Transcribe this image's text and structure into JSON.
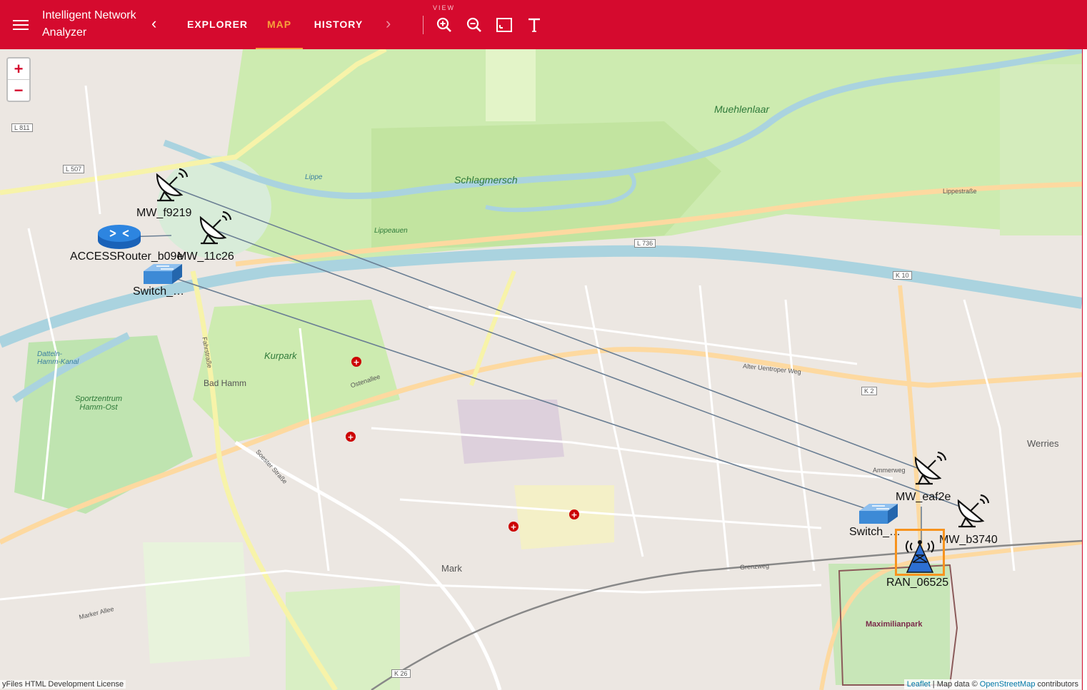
{
  "app": {
    "title": "Intelligent Network Analyzer"
  },
  "nav": {
    "tabs": [
      {
        "label": "EXPLORER",
        "active": false
      },
      {
        "label": "MAP",
        "active": true
      },
      {
        "label": "HISTORY",
        "active": false
      }
    ],
    "view_label": "VIEW"
  },
  "toolbar": {
    "tools": [
      "zoom-in-icon",
      "zoom-out-icon",
      "fit-content-icon",
      "text-icon"
    ]
  },
  "map": {
    "zoom_in": "+",
    "zoom_out": "−",
    "place_labels": {
      "muehlenlaar": "Muehlenlaar",
      "schlagmersch": "Schlagmersch",
      "kurpark": "Kurpark",
      "bad_hamm": "Bad Hamm",
      "werries": "Werries",
      "mark": "Mark",
      "maximilianpark": "Maximilianpark",
      "sportzentrum": "Sportzentrum Hamm-Ost",
      "datteln_kanal": "Datteln-Hamm-Kanal",
      "lippe": "Lippe",
      "lippeauen": "Lippeauen"
    },
    "street_labels": {
      "lippestrasse": "Lippestraße",
      "ostenallee": "Ostenallee",
      "alter_uentroper_weg": "Alter Uentroper Weg",
      "fahrstrasse": "Fahrstraße",
      "soester_strasse": "Soester Straße",
      "l736": "L 736",
      "l811": "L 811",
      "l507": "L 507",
      "k10": "K 10",
      "k2": "K 2",
      "k26": "K 26",
      "marker_allee": "Marker Allee",
      "grenzweg": "Grenzweg",
      "ammerweg": "Ammerweg"
    }
  },
  "nodes": [
    {
      "id": "mw_f9219",
      "label": "MW_f9219",
      "type": "microwave"
    },
    {
      "id": "mw_11c26",
      "label": "MW_11c26",
      "type": "microwave"
    },
    {
      "id": "access_router",
      "label": "ACCESSRouter_b09e",
      "type": "router"
    },
    {
      "id": "switch_1",
      "label": "Switch_…",
      "type": "switch"
    },
    {
      "id": "mw_eaf2e",
      "label": "MW_eaf2e",
      "type": "microwave"
    },
    {
      "id": "mw_b3740",
      "label": "MW_b3740",
      "type": "microwave"
    },
    {
      "id": "switch_2",
      "label": "Switch_…",
      "type": "switch"
    },
    {
      "id": "ran_06525",
      "label": "RAN_06525",
      "type": "ran",
      "selected": true
    }
  ],
  "colors": {
    "appbar": "#d50a2e",
    "active_tab": "#f7a23b",
    "edge": "#6b7f94",
    "selection": "#f7931e"
  },
  "attribution": {
    "license": "yFiles HTML Development License",
    "leaflet": "Leaflet",
    "map_data": "| Map data ©",
    "osm": "OpenStreetMap",
    "contributors": "contributors"
  }
}
